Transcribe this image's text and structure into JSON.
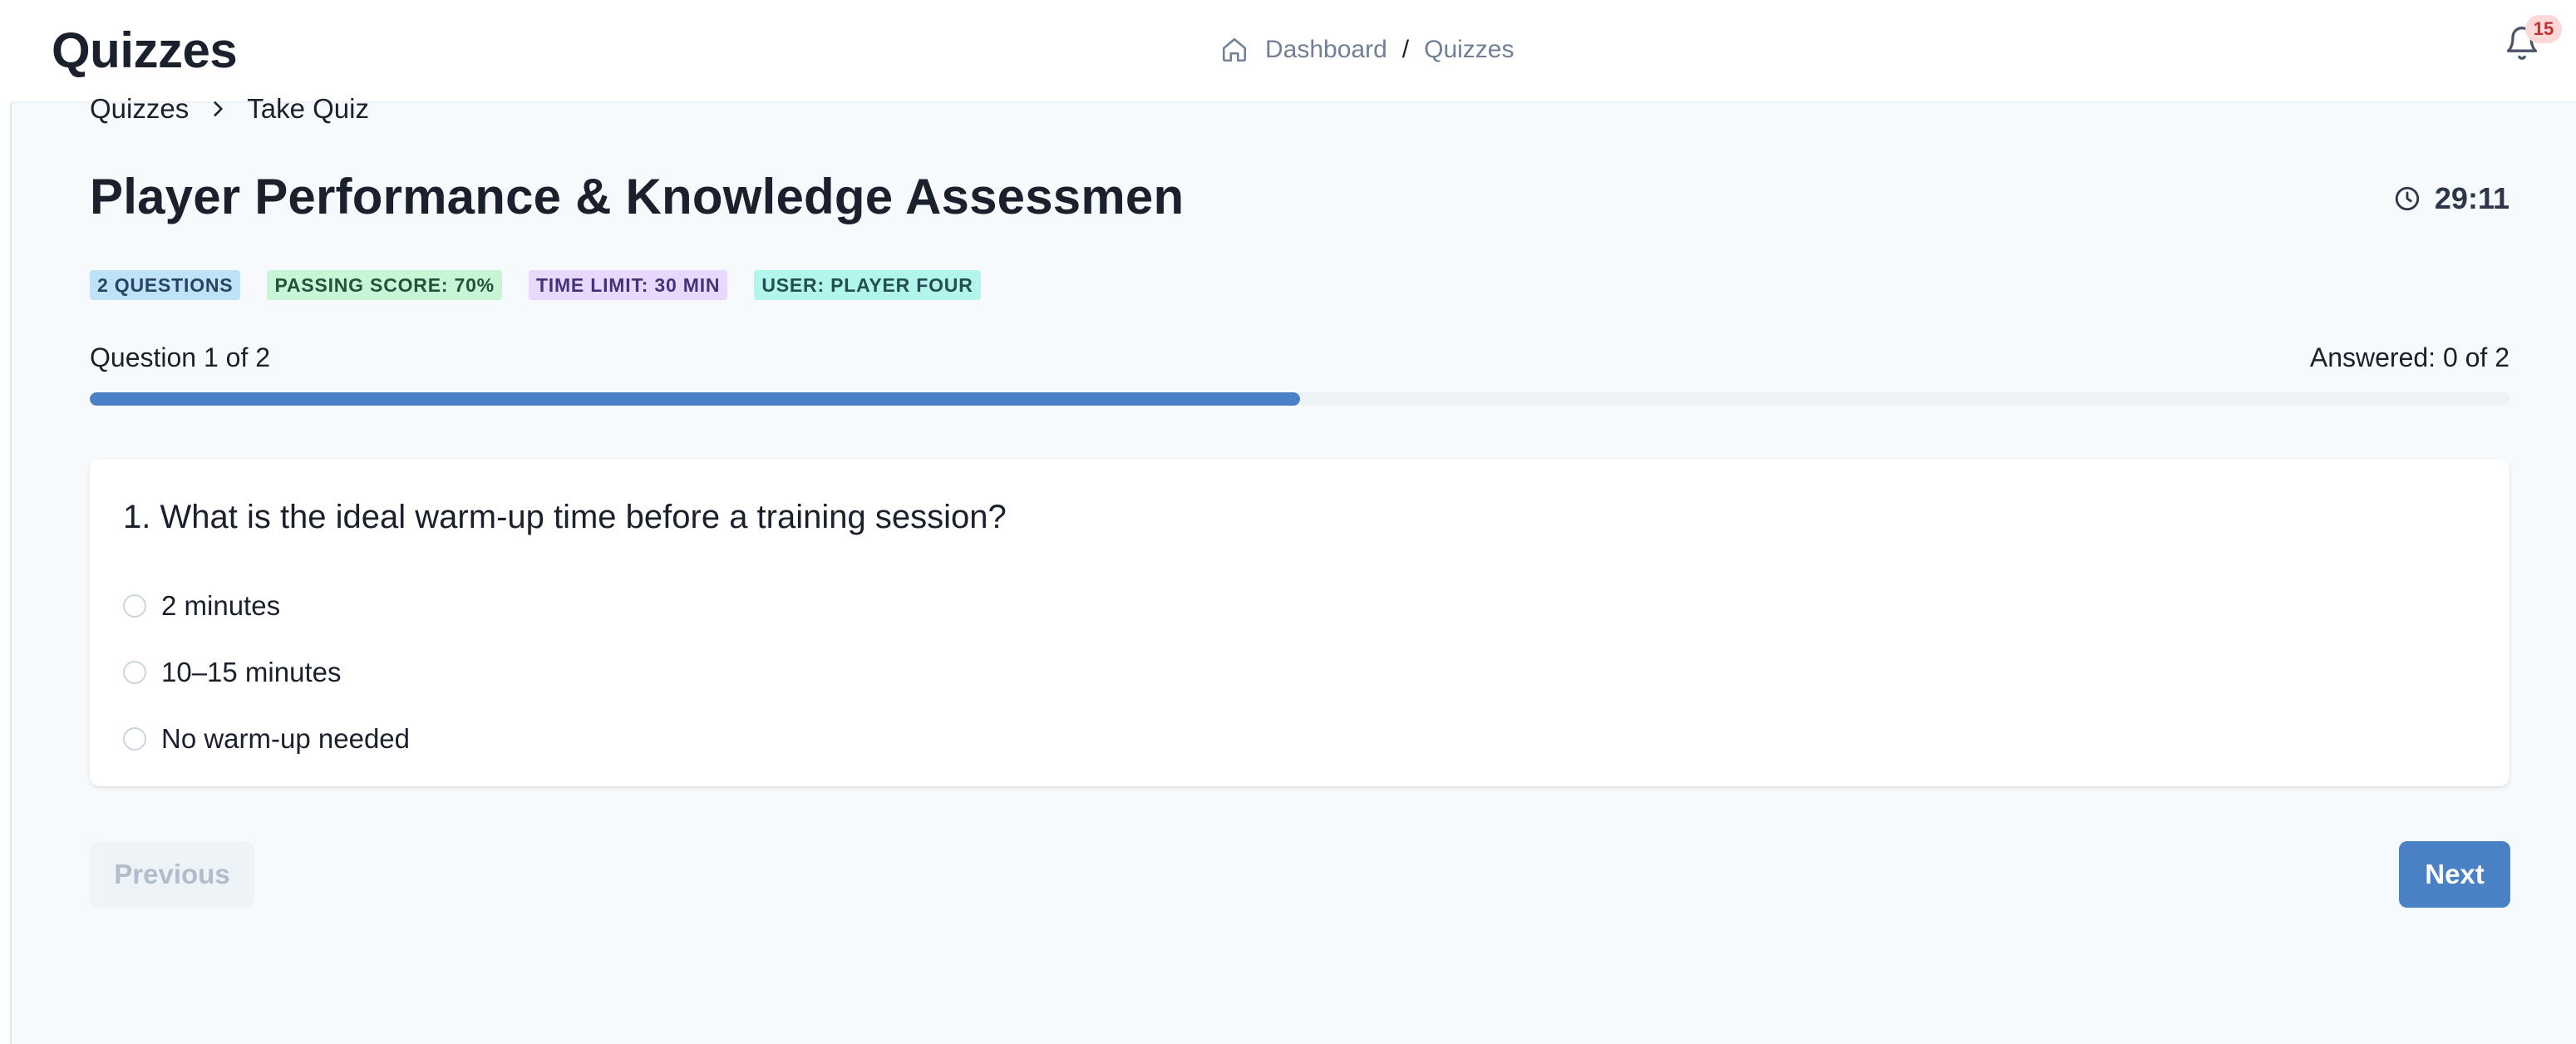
{
  "header": {
    "app_title": "Quizzes",
    "breadcrumb": {
      "home": "Dashboard",
      "separator": "/",
      "current": "Quizzes"
    },
    "notifications_count": "15"
  },
  "sub_breadcrumb": {
    "parent": "Quizzes",
    "current": "Take Quiz"
  },
  "quiz": {
    "title": "Player Performance & Knowledge Assessmen",
    "timer": "29:11",
    "tags": [
      {
        "label": "2 QUESTIONS",
        "bg": "#bee3f8",
        "color": "#2a4365"
      },
      {
        "label": "PASSING SCORE: 70%",
        "bg": "#c6f6d5",
        "color": "#22543d"
      },
      {
        "label": "TIME LIMIT: 30 MIN",
        "bg": "#e9d8fd",
        "color": "#44337a"
      },
      {
        "label": "USER: PLAYER FOUR",
        "bg": "#b2f5ea",
        "color": "#234e52"
      }
    ],
    "progress": {
      "question_label": "Question 1 of 2",
      "answered_label": "Answered: 0 of 2",
      "fraction": 0.5
    },
    "question": {
      "text": "1. What is the ideal warm-up time before a training session?",
      "options": [
        "2 minutes",
        "10–15 minutes",
        "No warm-up needed"
      ]
    }
  },
  "actions": {
    "previous": "Previous",
    "next": "Next"
  },
  "colors": {
    "accent": "#4a81c4",
    "badge_bg": "#fed7d7",
    "badge_text": "#c53030"
  }
}
